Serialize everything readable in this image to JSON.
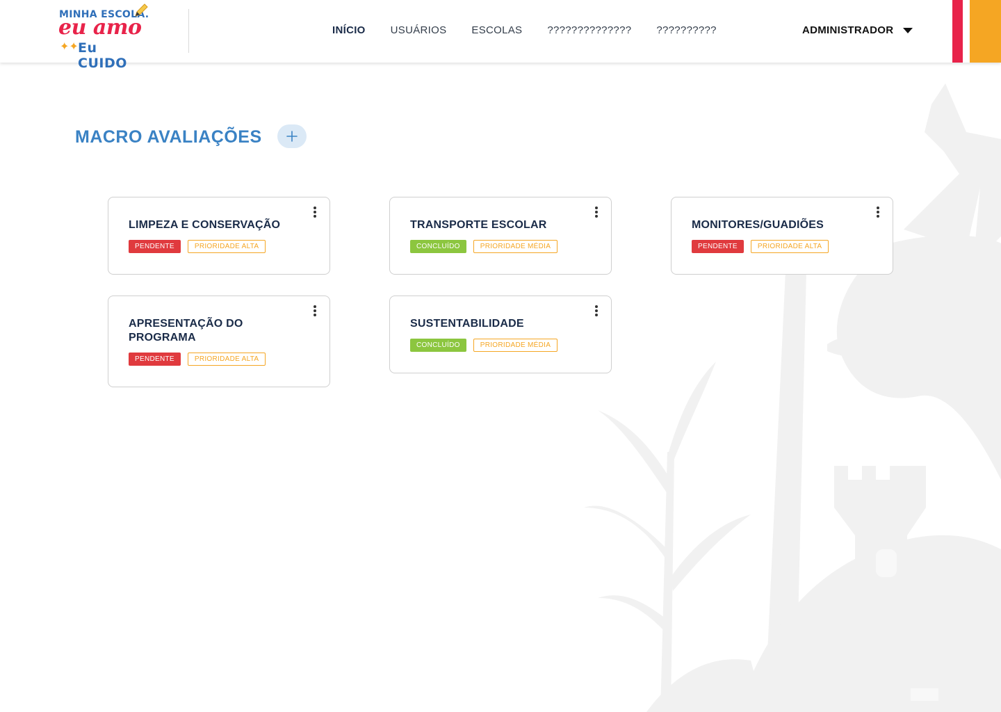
{
  "header": {
    "logo": {
      "line1": "MINHA ESCOLA.",
      "line2": "eu amo",
      "line3": "Eu CUIDO"
    },
    "nav": [
      {
        "label": "INÍCIO",
        "active": true
      },
      {
        "label": "USUÁRIOS",
        "active": false
      },
      {
        "label": "ESCOLAS",
        "active": false
      },
      {
        "label": "??????????????",
        "active": false
      },
      {
        "label": "??????????",
        "active": false
      }
    ],
    "user_menu": {
      "label": "ADMINISTRADOR",
      "icon": "caret-down-icon"
    },
    "accent_colors": {
      "red": "#e8234a",
      "orange": "#f5a623"
    }
  },
  "main": {
    "title": "MACRO AVALIAÇÕES",
    "add_button_icon": "plus-icon",
    "cards": [
      {
        "title": "LIMPEZA E CONSERVAÇÃO",
        "status": "PENDENTE",
        "status_type": "pendente",
        "priority": "PRIORIDADE ALTA"
      },
      {
        "title": "TRANSPORTE ESCOLAR",
        "status": "CONCLUÍDO",
        "status_type": "concluido",
        "priority": "PRIORIDADE MÉDIA"
      },
      {
        "title": "MONITORES/GUADIÕES",
        "status": "PENDENTE",
        "status_type": "pendente",
        "priority": "PRIORIDADE ALTA"
      },
      {
        "title": "APRESENTAÇÃO DO PROGRAMA",
        "status": "PENDENTE",
        "status_type": "pendente",
        "priority": "PRIORIDADE ALTA"
      },
      {
        "title": "SUSTENTABILIDADE",
        "status": "CONCLUÍDO",
        "status_type": "concluido",
        "priority": "PRIORIDADE MÉDIA"
      }
    ]
  },
  "colors": {
    "title_blue": "#3a82c4",
    "pendente": "#e03a3e",
    "concluido": "#8cc63f",
    "prioridade": "#f5a623"
  }
}
